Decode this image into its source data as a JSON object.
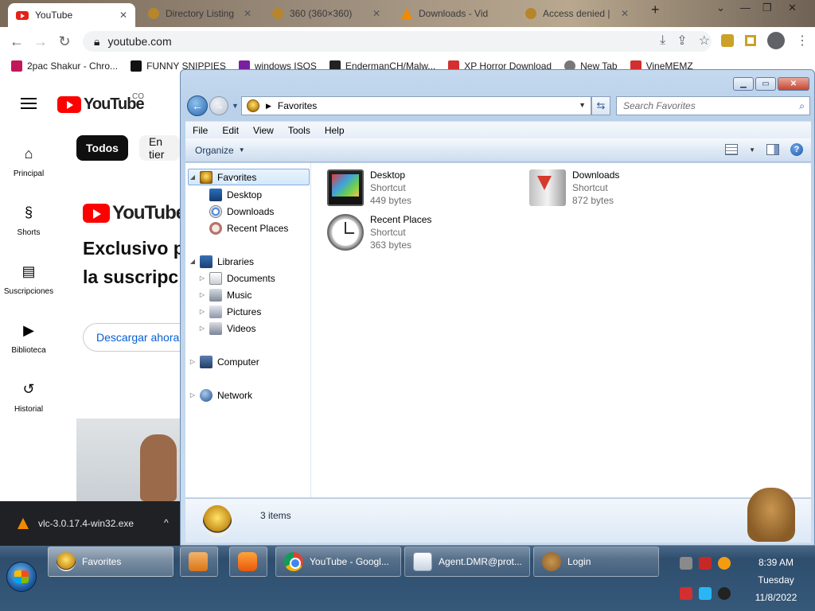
{
  "browser": {
    "tabs": [
      {
        "label": "YouTube",
        "close": "✕"
      },
      {
        "label": "Directory Listing",
        "close": "✕"
      },
      {
        "label": "360 (360×360)",
        "close": "✕"
      },
      {
        "label": "Downloads - Vid",
        "close": ""
      },
      {
        "label": "Access denied |",
        "close": "✕"
      }
    ],
    "new_tab": "+",
    "url": "youtube.com",
    "bookmarks": [
      {
        "label": "2pac Shakur - Chro...",
        "color": "#c2185b"
      },
      {
        "label": "FUNNY SNIPPIES",
        "color": "#111111"
      },
      {
        "label": "windows ISOS",
        "color": "#7b1fa2"
      },
      {
        "label": "EndermanCH/Malw...",
        "color": "#222222"
      },
      {
        "label": "XP Horror Download",
        "color": "#d32f2f"
      },
      {
        "label": "New Tab",
        "color": "#777777"
      },
      {
        "label": "VineMEMZ",
        "color": "#d32f2f"
      }
    ]
  },
  "youtube": {
    "logo_text": "YouTube",
    "country_code": "CO",
    "nav": [
      {
        "label": "Principal",
        "icon": "home-icon"
      },
      {
        "label": "Shorts",
        "icon": "shorts-icon"
      },
      {
        "label": "Suscripciones",
        "icon": "subscriptions-icon"
      },
      {
        "label": "Biblioteca",
        "icon": "library-icon"
      },
      {
        "label": "Historial",
        "icon": "history-icon"
      }
    ],
    "chips": [
      "Todos",
      "En tier"
    ],
    "premium_logo": "YouTube P",
    "promo_line1": "Exclusivo p",
    "promo_line2": "la suscripc",
    "promo_button": "Descargar ahora"
  },
  "download_bar": {
    "filename": "vlc-3.0.17.4-win32.exe",
    "chevron": "^"
  },
  "explorer": {
    "window_controls": {
      "minimize": "▁",
      "maximize": "▭",
      "close": "✕"
    },
    "address": "Favorites",
    "search_placeholder": "Search Favorites",
    "menu": [
      "File",
      "Edit",
      "View",
      "Tools",
      "Help"
    ],
    "organize": "Organize",
    "nav_tree": {
      "favorites": "Favorites",
      "favorites_children": [
        "Desktop",
        "Downloads",
        "Recent Places"
      ],
      "libraries": "Libraries",
      "libraries_children": [
        "Documents",
        "Music",
        "Pictures",
        "Videos"
      ],
      "computer": "Computer",
      "network": "Network"
    },
    "items": [
      {
        "name": "Desktop",
        "type": "Shortcut",
        "size": "449 bytes",
        "icon": "desktop-shortcut-icon"
      },
      {
        "name": "Downloads",
        "type": "Shortcut",
        "size": "872 bytes",
        "icon": "downloads-shortcut-icon"
      },
      {
        "name": "Recent Places",
        "type": "Shortcut",
        "size": "363 bytes",
        "icon": "recent-places-shortcut-icon"
      }
    ],
    "status": "3 items"
  },
  "taskbar": {
    "buttons": [
      {
        "label": "Favorites",
        "icon": "favorites-icon"
      },
      {
        "label": "",
        "icon": "media-player-icon"
      },
      {
        "label": "",
        "icon": "uc-browser-icon"
      },
      {
        "label": "YouTube - Googl...",
        "icon": "chrome-icon"
      },
      {
        "label": "Agent.DMR@prot...",
        "icon": "document-icon"
      },
      {
        "label": "Login",
        "icon": "gopher-icon"
      }
    ],
    "clock": {
      "time": "8:39 AM",
      "day": "Tuesday",
      "date": "11/8/2022"
    }
  }
}
